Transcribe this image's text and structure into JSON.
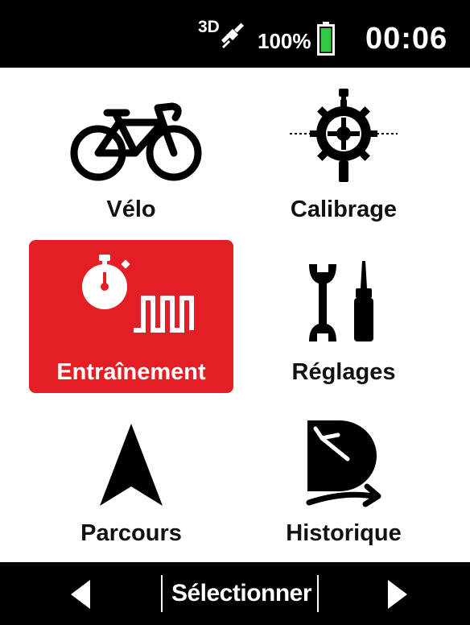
{
  "status": {
    "gps_label": "3D",
    "battery_label": "100%",
    "clock": "00:06"
  },
  "menu": {
    "items": [
      {
        "label": "Vélo",
        "icon": "bike-icon"
      },
      {
        "label": "Calibrage",
        "icon": "chainring-crank-icon"
      },
      {
        "label": "Entraînement",
        "icon": "stopwatch-intervals-icon",
        "selected": true
      },
      {
        "label": "Réglages",
        "icon": "wrench-screwdriver-icon"
      },
      {
        "label": "Parcours",
        "icon": "navigation-arrow-icon"
      },
      {
        "label": "Historique",
        "icon": "history-clock-icon"
      }
    ]
  },
  "bottom": {
    "select_label": "Sélectionner",
    "left_icon": "arrow-left-icon",
    "right_icon": "arrow-right-icon"
  },
  "colors": {
    "accent": "#e31e24",
    "bars": "#000000",
    "battery": "#2ecc40"
  }
}
